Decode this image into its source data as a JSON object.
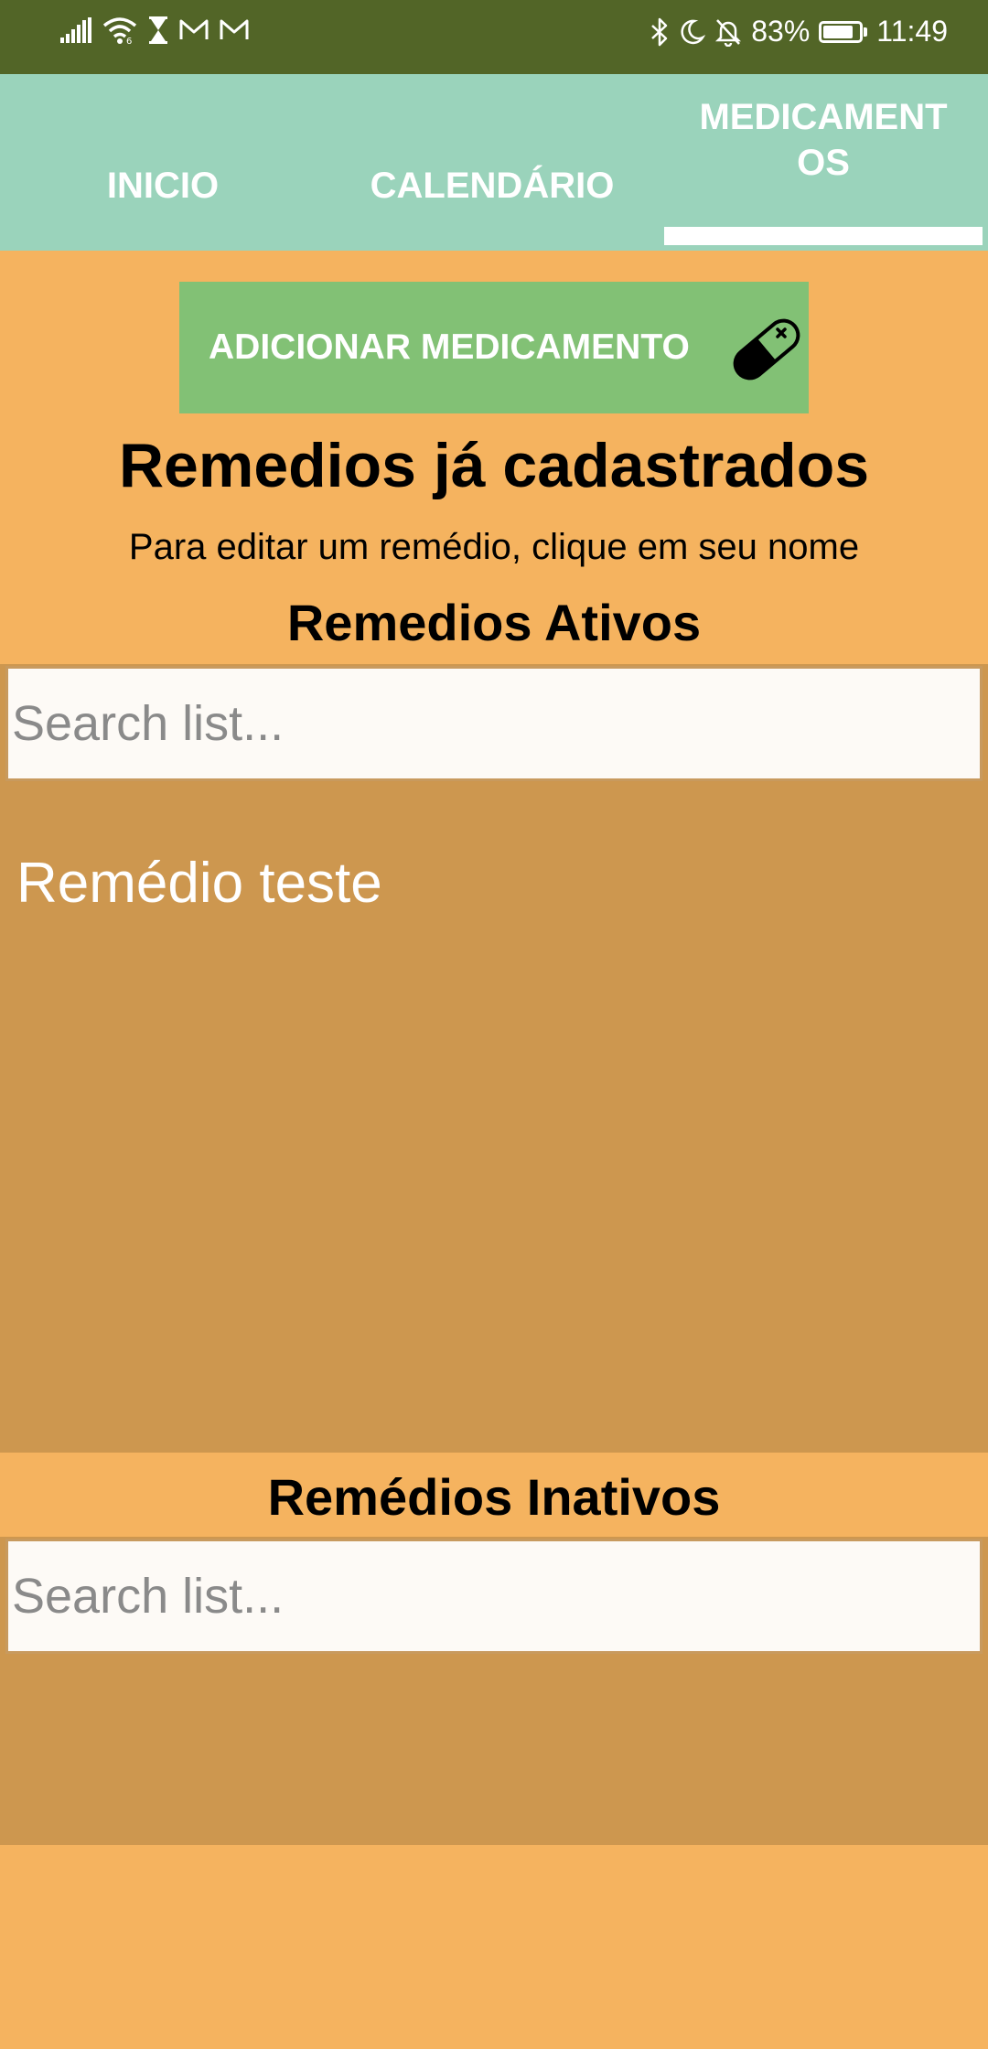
{
  "status_bar": {
    "battery": "83%",
    "time": "11:49",
    "icons": [
      "signal-icon",
      "wifi-icon",
      "hourglass-icon",
      "mail-icon",
      "mail-icon",
      "bluetooth-icon",
      "moon-icon",
      "notifications-off-icon",
      "battery-icon"
    ]
  },
  "tabs": [
    {
      "label": "INICIO",
      "selected": false
    },
    {
      "label": "CALENDÁRIO",
      "selected": false
    },
    {
      "label": "MEDICAMENT OS",
      "selected": true
    }
  ],
  "add_button": {
    "label": "ADICIONAR MEDICAMENTO",
    "icon": "pill-icon"
  },
  "page": {
    "title": "Remedios já cadastrados",
    "hint": "Para editar um remédio, clique em seu nome"
  },
  "active": {
    "title": "Remedios Ativos",
    "search_placeholder": "Search list...",
    "items": [
      "Remédio teste"
    ]
  },
  "inactive": {
    "title": "Remédios Inativos",
    "search_placeholder": "Search list...",
    "items": []
  },
  "colors": {
    "status_bar": "#526527",
    "tab_bar": "#9ad3bb",
    "background": "#f5b35f",
    "list_panel": "#cd974f",
    "add_button": "#82c175"
  }
}
